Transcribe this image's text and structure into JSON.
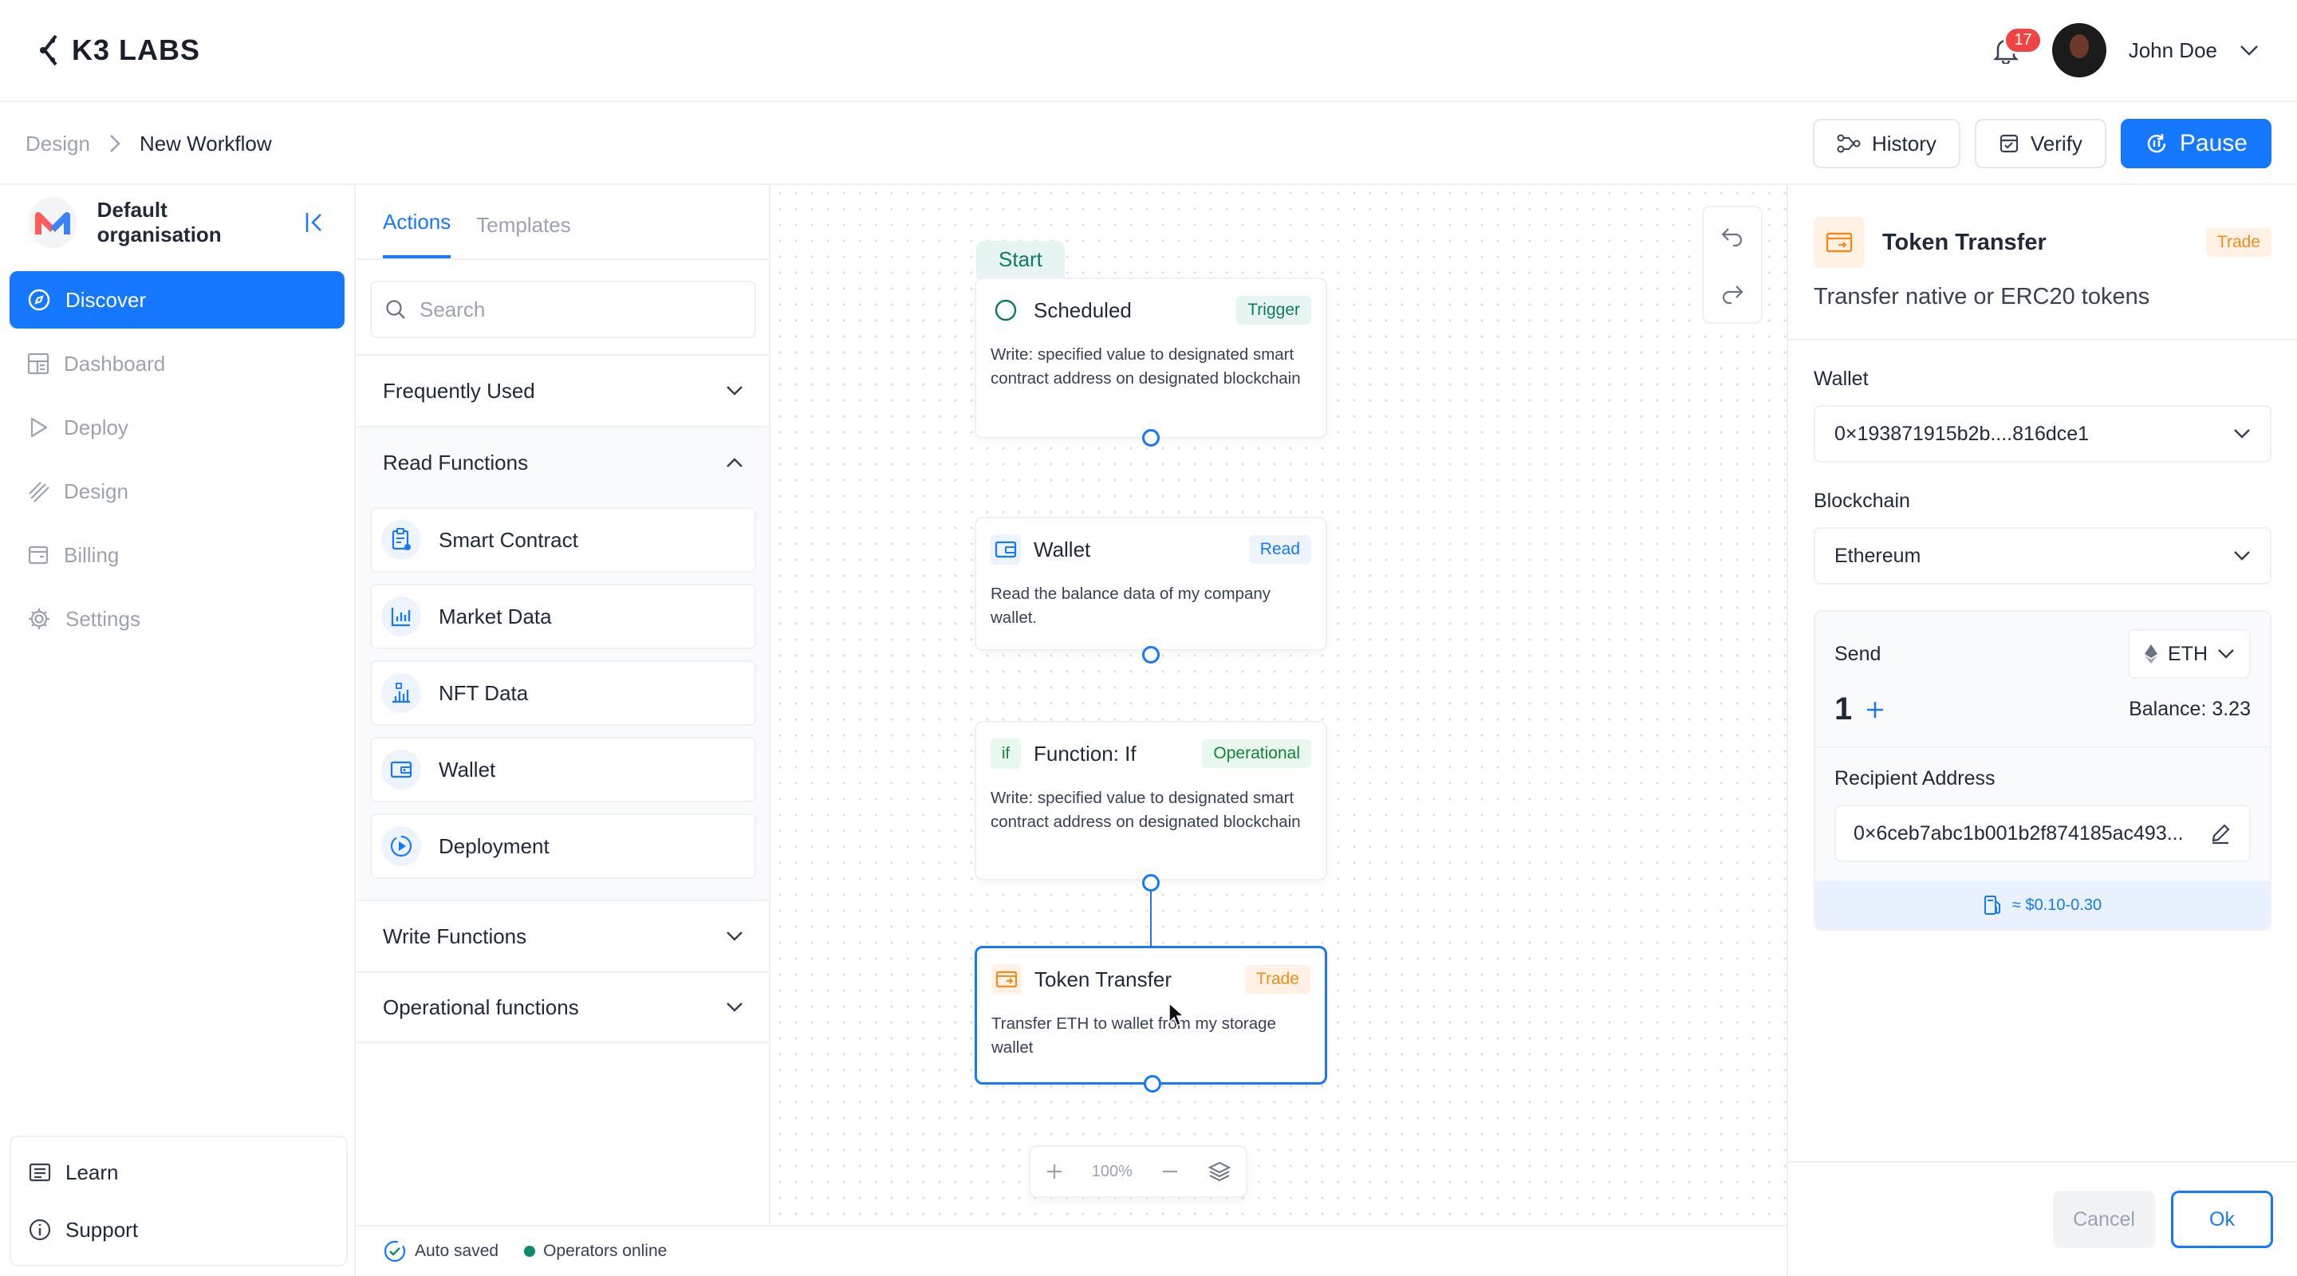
{
  "header": {
    "logo_text": "K3 LABS",
    "notification_count": "17",
    "user_name": "John Doe"
  },
  "breadcrumb": {
    "parent": "Design",
    "current": "New Workflow"
  },
  "toolbar": {
    "history_label": "History",
    "verify_label": "Verify",
    "pause_label": "Pause"
  },
  "sidebar": {
    "org_name": "Default organisation",
    "items": [
      {
        "label": "Discover",
        "icon": "compass-icon",
        "active": true
      },
      {
        "label": "Dashboard",
        "icon": "dashboard-icon"
      },
      {
        "label": "Deploy",
        "icon": "play-icon"
      },
      {
        "label": "Design",
        "icon": "design-icon"
      },
      {
        "label": "Billing",
        "icon": "billing-icon"
      },
      {
        "label": "Settings",
        "icon": "gear-icon"
      }
    ],
    "bottom_items": [
      {
        "label": "Learn",
        "icon": "book-icon"
      },
      {
        "label": "Support",
        "icon": "info-icon"
      }
    ]
  },
  "actions_panel": {
    "tabs": [
      "Actions",
      "Templates"
    ],
    "search_placeholder": "Search",
    "sections": {
      "frequent": "Frequently Used",
      "read": "Read Functions",
      "write": "Write Functions",
      "operational": "Operational functions"
    },
    "read_functions": [
      "Smart Contract",
      "Market Data",
      "NFT Data",
      "Wallet",
      "Deployment"
    ]
  },
  "status": {
    "autosave": "Auto saved",
    "operators": "Operators online"
  },
  "canvas": {
    "start_label": "Start",
    "zoom": "100%",
    "nodes": [
      {
        "title": "Scheduled",
        "tag": "Trigger",
        "desc": "Write: specified value to designated smart contract address on designated blockchain"
      },
      {
        "title": "Wallet",
        "tag": "Read",
        "desc": "Read the balance data of my company wallet."
      },
      {
        "title": "Function: If",
        "tag": "Operational",
        "icon_text": "if",
        "desc": "Write: specified value to designated smart contract address on designated blockchain"
      },
      {
        "title": "Token Transfer",
        "tag": "Trade",
        "desc": "Transfer ETH to wallet from my storage wallet"
      }
    ]
  },
  "details": {
    "title": "Token Transfer",
    "tag": "Trade",
    "subtitle": "Transfer native or ERC20 tokens",
    "wallet_label": "Wallet",
    "wallet_value": "0×193871915b2b....816dce1",
    "blockchain_label": "Blockchain",
    "blockchain_value": "Ethereum",
    "send_label": "Send",
    "coin": "ETH",
    "amount": "1",
    "balance": "Balance: 3.23",
    "recipient_label": "Recipient Address",
    "recipient_value": "0×6ceb7abc1b001b2f874185ac493...",
    "fee": "≈ $0.10-0.30",
    "cancel_label": "Cancel",
    "ok_label": "Ok"
  },
  "colors": {
    "accent": "#1677ff",
    "trade": "#f08c1a",
    "trigger": "#0f7a60"
  }
}
